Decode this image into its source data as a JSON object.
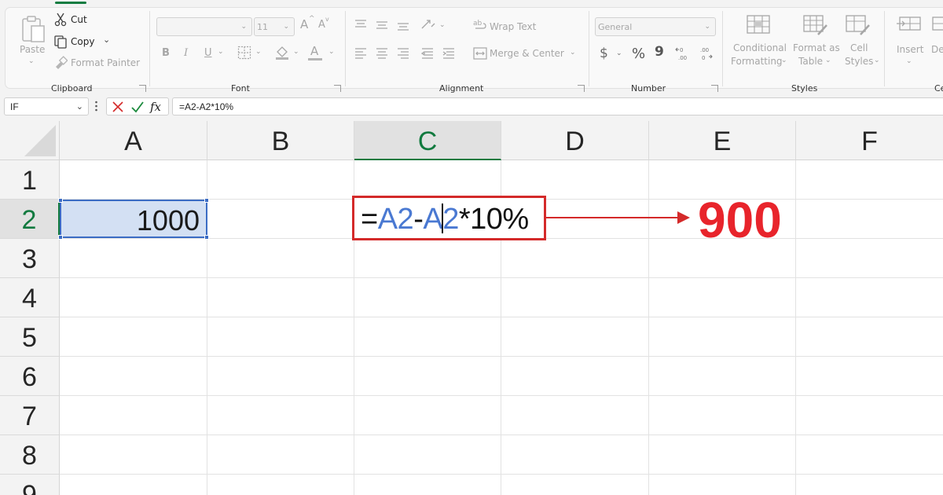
{
  "ribbon": {
    "clipboard": {
      "label": "Clipboard",
      "paste": "Paste",
      "cut": "Cut",
      "copy": "Copy",
      "format_painter": "Format Painter"
    },
    "font": {
      "label": "Font",
      "family_value": "",
      "size_value": "11",
      "bold": "B",
      "italic": "I",
      "underline": "U",
      "grow": "A",
      "shrink": "A",
      "font_color": "A"
    },
    "alignment": {
      "label": "Alignment",
      "wrap_text": "Wrap Text",
      "merge_center": "Merge & Center"
    },
    "number": {
      "label": "Number",
      "format_value": "General",
      "currency": "$",
      "percent": "%",
      "comma": "9"
    },
    "styles": {
      "label": "Styles",
      "conditional_line1": "Conditional",
      "conditional_line2": "Formatting",
      "format_table_line1": "Format as",
      "format_table_line2": "Table",
      "cell_styles_line1": "Cell",
      "cell_styles_line2": "Styles"
    },
    "cells": {
      "label": "Ce",
      "insert": "Insert",
      "delete": "De"
    }
  },
  "formula_bar": {
    "name_box": "IF",
    "fx": "fx",
    "formula": "=A2-A2*10%"
  },
  "grid": {
    "columns": [
      "A",
      "B",
      "C",
      "D",
      "E",
      "F"
    ],
    "rows": [
      "1",
      "2",
      "3",
      "4",
      "5",
      "6",
      "7",
      "8",
      "9"
    ],
    "active_column": "C",
    "active_row": "2"
  },
  "cells": {
    "A2": "1000"
  },
  "formula_edit": {
    "eq": "=",
    "ref1": "A2",
    "minus": "-",
    "ref2_a": "A",
    "ref2_b": "2",
    "rest": "*10%"
  },
  "annotation": {
    "result": "900",
    "color": "#e8242b"
  }
}
